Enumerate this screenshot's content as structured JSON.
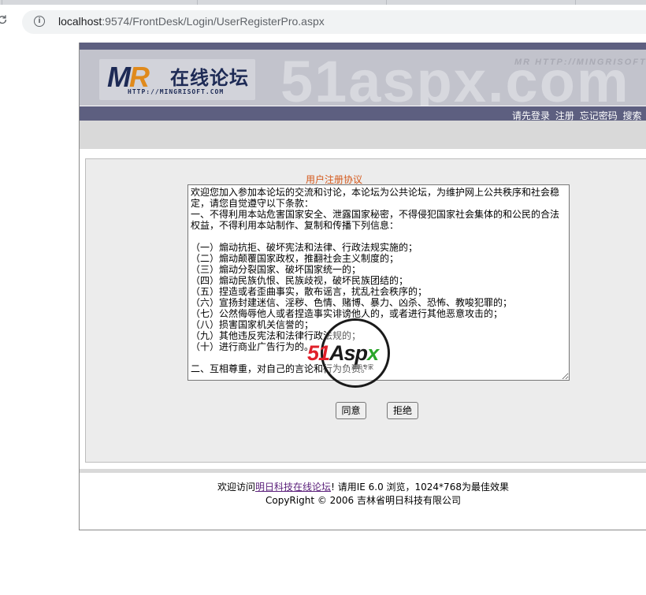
{
  "browser": {
    "url_host": "localhost",
    "url_rest": ":9574/FrontDesk/Login/UserRegisterPro.aspx"
  },
  "banner": {
    "logo_mr": "M",
    "logo_mr_accent": "R",
    "logo_cn": "在线论坛",
    "logo_url": "HTTP://MINGRISOFT.COM",
    "watermark": "51aspx.com",
    "watermark_small": "MR HTTP://MINGRISOFT.COM"
  },
  "nav": {
    "items": [
      "请先登录",
      "注册",
      "忘记密码",
      "搜索"
    ]
  },
  "agreement": {
    "title": "用户注册协议",
    "text": "欢迎您加入参加本论坛的交流和讨论，本论坛为公共论坛，为维护网上公共秩序和社会稳定，请您自觉遵守以下条款：\n一、不得利用本站危害国家安全、泄露国家秘密，不得侵犯国家社会集体的和公民的合法权益，不得利用本站制作、复制和传播下列信息：\n\n（一）煽动抗拒、破坏宪法和法律、行政法规实施的；\n（二）煽动颠覆国家政权，推翻社会主义制度的；\n（三）煽动分裂国家、破坏国家统一的；\n（四）煽动民族仇恨、民族歧视，破坏民族团结的；\n（五）捏造或者歪曲事实，散布谣言，扰乱社会秩序的；\n（六）宣扬封建迷信、淫秽、色情、赌博、暴力、凶杀、恐怖、教唆犯罪的；\n（七）公然侮辱他人或者捏造事实诽谤他人的，或者进行其他恶意攻击的；\n（八）损害国家机关信誉的；\n（九）其他违反宪法和法律行政法规的；\n（十）进行商业广告行为的。\n\n二、互相尊重，对自己的言论和行为负责。",
    "agree_label": "同意",
    "reject_label": "拒绝"
  },
  "stamp": {
    "num": "51",
    "word": "Asp",
    "x": "x",
    "sub": "源码专家"
  },
  "footer": {
    "prefix": "欢迎访问",
    "link": "明日科技在线论坛",
    "suffix": "! 请用IE 6.0 浏览，1024*768为最佳效果",
    "copyright": "CopyRight © 2006 吉林省明日科技有限公司"
  }
}
